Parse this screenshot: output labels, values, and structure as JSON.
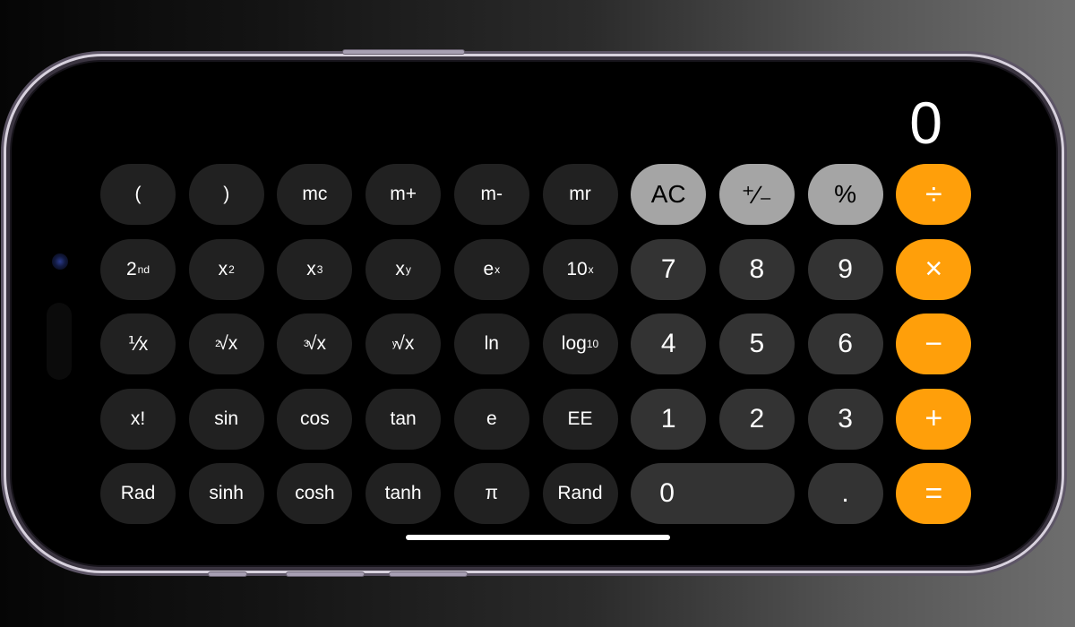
{
  "app": "Calculator (Scientific, landscape)",
  "display": {
    "value": "0"
  },
  "colors": {
    "background": "#000000",
    "scientific_key": "#212121",
    "number_key": "#333333",
    "function_key": "#a5a5a5",
    "operator_key": "#ff9f0a",
    "text": "#ffffff"
  },
  "rows": [
    {
      "scientific": [
        {
          "id": "open-paren",
          "base": "(",
          "sup": "",
          "sub": "",
          "pre": ""
        },
        {
          "id": "close-paren",
          "base": ")",
          "sup": "",
          "sub": "",
          "pre": ""
        },
        {
          "id": "mc",
          "base": "mc",
          "sup": "",
          "sub": "",
          "pre": ""
        },
        {
          "id": "m-plus",
          "base": "m+",
          "sup": "",
          "sub": "",
          "pre": ""
        },
        {
          "id": "m-minus",
          "base": "m-",
          "sup": "",
          "sub": "",
          "pre": ""
        },
        {
          "id": "mr",
          "base": "mr",
          "sup": "",
          "sub": "",
          "pre": ""
        }
      ],
      "basic": [
        {
          "id": "ac",
          "label": "AC",
          "kind": "fn"
        },
        {
          "id": "plus-minus",
          "label": "⁺∕₋",
          "kind": "fn"
        },
        {
          "id": "percent",
          "label": "%",
          "kind": "fn"
        },
        {
          "id": "divide",
          "label": "÷",
          "kind": "op"
        }
      ]
    },
    {
      "scientific": [
        {
          "id": "second",
          "base": "2",
          "sup": "nd",
          "sub": "",
          "pre": ""
        },
        {
          "id": "x-squared",
          "base": "x",
          "sup": "2",
          "sub": "",
          "pre": ""
        },
        {
          "id": "x-cubed",
          "base": "x",
          "sup": "3",
          "sub": "",
          "pre": ""
        },
        {
          "id": "x-to-y",
          "base": "x",
          "sup": "y",
          "sub": "",
          "pre": ""
        },
        {
          "id": "e-to-x",
          "base": "e",
          "sup": "x",
          "sub": "",
          "pre": ""
        },
        {
          "id": "ten-to-x",
          "base": "10",
          "sup": "x",
          "sub": "",
          "pre": ""
        }
      ],
      "basic": [
        {
          "id": "seven",
          "label": "7",
          "kind": "num"
        },
        {
          "id": "eight",
          "label": "8",
          "kind": "num"
        },
        {
          "id": "nine",
          "label": "9",
          "kind": "num"
        },
        {
          "id": "multiply",
          "label": "×",
          "kind": "op"
        }
      ]
    },
    {
      "scientific": [
        {
          "id": "reciprocal",
          "base": "⅟x",
          "sup": "",
          "sub": "",
          "pre": ""
        },
        {
          "id": "square-root",
          "base": "√x",
          "sup": "",
          "sub": "",
          "pre": "2"
        },
        {
          "id": "cube-root",
          "base": "√x",
          "sup": "",
          "sub": "",
          "pre": "3"
        },
        {
          "id": "y-root",
          "base": "√x",
          "sup": "",
          "sub": "",
          "pre": "y"
        },
        {
          "id": "ln",
          "base": "ln",
          "sup": "",
          "sub": "",
          "pre": ""
        },
        {
          "id": "log10",
          "base": "log",
          "sup": "",
          "sub": "10",
          "pre": ""
        }
      ],
      "basic": [
        {
          "id": "four",
          "label": "4",
          "kind": "num"
        },
        {
          "id": "five",
          "label": "5",
          "kind": "num"
        },
        {
          "id": "six",
          "label": "6",
          "kind": "num"
        },
        {
          "id": "subtract",
          "label": "−",
          "kind": "op"
        }
      ]
    },
    {
      "scientific": [
        {
          "id": "factorial",
          "base": "x!",
          "sup": "",
          "sub": "",
          "pre": ""
        },
        {
          "id": "sin",
          "base": "sin",
          "sup": "",
          "sub": "",
          "pre": ""
        },
        {
          "id": "cos",
          "base": "cos",
          "sup": "",
          "sub": "",
          "pre": ""
        },
        {
          "id": "tan",
          "base": "tan",
          "sup": "",
          "sub": "",
          "pre": ""
        },
        {
          "id": "e",
          "base": "e",
          "sup": "",
          "sub": "",
          "pre": ""
        },
        {
          "id": "ee",
          "base": "EE",
          "sup": "",
          "sub": "",
          "pre": ""
        }
      ],
      "basic": [
        {
          "id": "one",
          "label": "1",
          "kind": "num"
        },
        {
          "id": "two",
          "label": "2",
          "kind": "num"
        },
        {
          "id": "three",
          "label": "3",
          "kind": "num"
        },
        {
          "id": "add",
          "label": "+",
          "kind": "op"
        }
      ]
    },
    {
      "scientific": [
        {
          "id": "rad",
          "base": "Rad",
          "sup": "",
          "sub": "",
          "pre": ""
        },
        {
          "id": "sinh",
          "base": "sinh",
          "sup": "",
          "sub": "",
          "pre": ""
        },
        {
          "id": "cosh",
          "base": "cosh",
          "sup": "",
          "sub": "",
          "pre": ""
        },
        {
          "id": "tanh",
          "base": "tanh",
          "sup": "",
          "sub": "",
          "pre": ""
        },
        {
          "id": "pi",
          "base": "π",
          "sup": "",
          "sub": "",
          "pre": ""
        },
        {
          "id": "rand",
          "base": "Rand",
          "sup": "",
          "sub": "",
          "pre": ""
        }
      ],
      "basic": [
        {
          "id": "zero",
          "label": "0",
          "kind": "num",
          "wide": true
        },
        {
          "id": "decimal",
          "label": ".",
          "kind": "num"
        },
        {
          "id": "equals",
          "label": "=",
          "kind": "op"
        }
      ]
    }
  ]
}
